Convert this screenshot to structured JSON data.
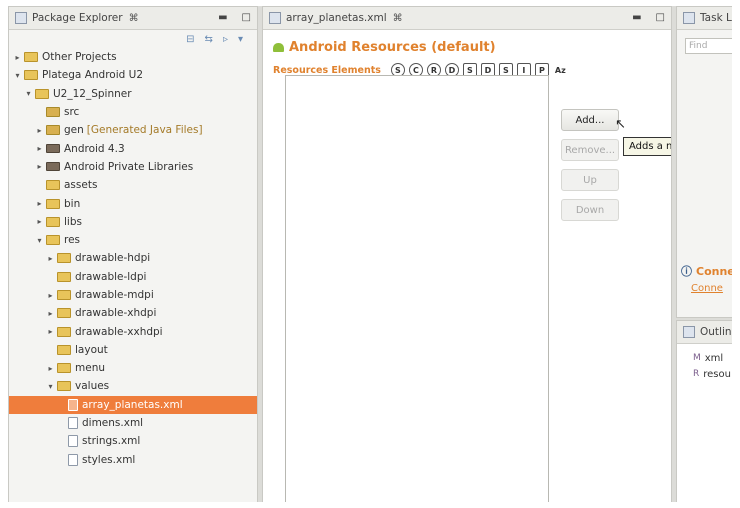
{
  "package_explorer": {
    "tab_title": "Package Explorer",
    "tab_close": "⌘",
    "tree": [
      {
        "label": "Other Projects",
        "indent": 0,
        "arrow": "▸",
        "icon": "project"
      },
      {
        "label": "Platega Android U2",
        "indent": 0,
        "arrow": "▾",
        "icon": "project"
      },
      {
        "label": "U2_12_Spinner",
        "indent": 1,
        "arrow": "▾",
        "icon": "project"
      },
      {
        "label": "src",
        "indent": 2,
        "arrow": "",
        "icon": "src"
      },
      {
        "label": "gen",
        "extra": "[Generated Java Files]",
        "indent": 2,
        "arrow": "▸",
        "icon": "src"
      },
      {
        "label": "Android 4.3",
        "indent": 2,
        "arrow": "▸",
        "icon": "lib"
      },
      {
        "label": "Android Private Libraries",
        "indent": 2,
        "arrow": "▸",
        "icon": "lib"
      },
      {
        "label": "assets",
        "indent": 2,
        "arrow": "",
        "icon": "folder"
      },
      {
        "label": "bin",
        "indent": 2,
        "arrow": "▸",
        "icon": "folder"
      },
      {
        "label": "libs",
        "indent": 2,
        "arrow": "▸",
        "icon": "folder"
      },
      {
        "label": "res",
        "indent": 2,
        "arrow": "▾",
        "icon": "folder"
      },
      {
        "label": "drawable-hdpi",
        "indent": 3,
        "arrow": "▸",
        "icon": "folder"
      },
      {
        "label": "drawable-ldpi",
        "indent": 3,
        "arrow": "",
        "icon": "folder"
      },
      {
        "label": "drawable-mdpi",
        "indent": 3,
        "arrow": "▸",
        "icon": "folder"
      },
      {
        "label": "drawable-xhdpi",
        "indent": 3,
        "arrow": "▸",
        "icon": "folder"
      },
      {
        "label": "drawable-xxhdpi",
        "indent": 3,
        "arrow": "▸",
        "icon": "folder"
      },
      {
        "label": "layout",
        "indent": 3,
        "arrow": "",
        "icon": "folder"
      },
      {
        "label": "menu",
        "indent": 3,
        "arrow": "▸",
        "icon": "folder"
      },
      {
        "label": "values",
        "indent": 3,
        "arrow": "▾",
        "icon": "folder"
      },
      {
        "label": "array_planetas.xml",
        "indent": 4,
        "arrow": "",
        "icon": "file",
        "selected": true
      },
      {
        "label": "dimens.xml",
        "indent": 4,
        "arrow": "",
        "icon": "file"
      },
      {
        "label": "strings.xml",
        "indent": 4,
        "arrow": "",
        "icon": "file"
      },
      {
        "label": "styles.xml",
        "indent": 4,
        "arrow": "",
        "icon": "file"
      }
    ]
  },
  "editor": {
    "tab_title": "array_planetas.xml",
    "tab_close": "⌘",
    "heading": "Android Resources (default)",
    "elements_label": "Resources Elements",
    "element_badges": [
      "S",
      "C",
      "R",
      "D",
      "S",
      "D",
      "S",
      "I",
      "P"
    ],
    "sort_label": "Az",
    "buttons": {
      "add": "Add...",
      "remove": "Remove...",
      "up": "Up",
      "down": "Down"
    },
    "tooltip": "Adds a new element."
  },
  "task_list": {
    "tab_title": "Task Lis",
    "find_placeholder": "Find",
    "connect_title": "Conne",
    "connect_link": "Conne"
  },
  "outline": {
    "tab_title": "Outline",
    "items": [
      {
        "label": "xml",
        "icon": "M"
      },
      {
        "label": "resou",
        "icon": "R"
      }
    ]
  },
  "colors": {
    "accent": "#e0822e",
    "selection": "#ef7d3c"
  }
}
